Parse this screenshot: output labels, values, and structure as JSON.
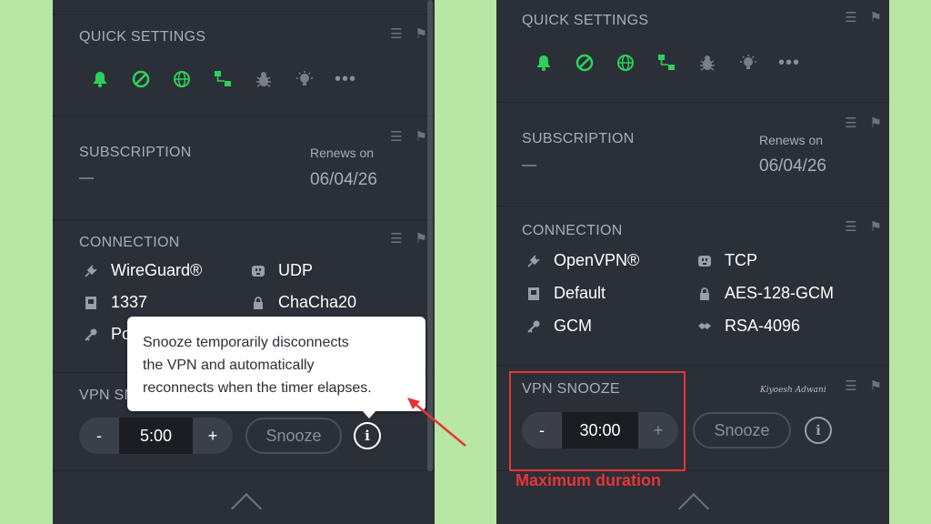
{
  "colors": {
    "background": "#b7e6a5",
    "panel": "#2b2f38",
    "accent_green": "#2ed158",
    "annotation_red": "#e53535"
  },
  "icons": {
    "section_tools": [
      "list-icon",
      "bookmark-icon"
    ],
    "quick_settings": [
      "bell-icon",
      "block-icon",
      "globe-icon",
      "network-icon",
      "bug-icon",
      "lightbulb-icon",
      "more-icon"
    ],
    "connection": [
      "plug-icon",
      "port-icon",
      "lock-icon",
      "key-icon",
      "handshake-icon"
    ]
  },
  "left_panel": {
    "quick_settings": {
      "title": "QUICK SETTINGS",
      "more": "•••"
    },
    "subscription": {
      "title": "SUBSCRIPTION",
      "value": "—",
      "renews_label": "Renews on",
      "renews_date": "06/04/26"
    },
    "connection": {
      "title": "CONNECTION",
      "items": [
        {
          "text": "WireGuard®",
          "icon": "plug-icon"
        },
        {
          "text": "UDP",
          "icon": "port-icon"
        },
        {
          "text": "1337",
          "icon": "network-port-icon"
        },
        {
          "text": "ChaCha20",
          "icon": "lock-icon"
        },
        {
          "text": "Po",
          "icon": "key-icon"
        }
      ]
    },
    "vpn_snooze": {
      "title": "VPN SN",
      "minus": "-",
      "value": "5:00",
      "plus": "+",
      "snooze_label": "Snooze",
      "info": "i"
    },
    "tooltip": {
      "lines": [
        "Snooze temporarily disconnects",
        "the VPN and automatically",
        "reconnects when the timer elapses."
      ]
    }
  },
  "right_panel": {
    "quick_settings": {
      "title": "QUICK SETTINGS",
      "more": "•••"
    },
    "subscription": {
      "title": "SUBSCRIPTION",
      "value": "—",
      "renews_label": "Renews on",
      "renews_date": "06/04/26"
    },
    "connection": {
      "title": "CONNECTION",
      "items": [
        {
          "text": "OpenVPN®",
          "icon": "plug-icon"
        },
        {
          "text": "TCP",
          "icon": "port-icon"
        },
        {
          "text": "Default",
          "icon": "network-port-icon"
        },
        {
          "text": "AES-128-GCM",
          "icon": "lock-icon"
        },
        {
          "text": "GCM",
          "icon": "key-icon"
        },
        {
          "text": "RSA-4096",
          "icon": "handshake-icon"
        }
      ]
    },
    "vpn_snooze": {
      "title": "VPN SNOOZE",
      "minus": "-",
      "value": "30:00",
      "plus": "+",
      "snooze_label": "Snooze",
      "info": "i"
    },
    "signature": "Kiyoesh Adwani"
  },
  "annotation": {
    "label": "Maximum duration"
  }
}
